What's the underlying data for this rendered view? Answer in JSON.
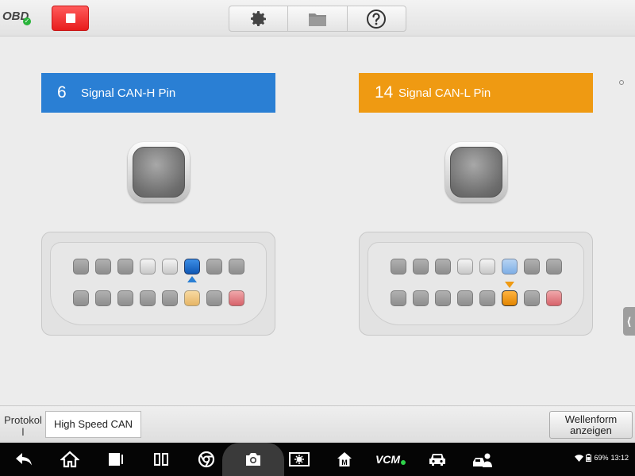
{
  "topbar": {
    "obd_label": "OBD",
    "obd_check": "✓",
    "tools": [
      "settings",
      "folder",
      "help"
    ]
  },
  "signals": {
    "left": {
      "number": "6",
      "label": "Signal CAN-H Pin"
    },
    "right": {
      "number": "14",
      "label": "Signal CAN-L Pin"
    }
  },
  "colors": {
    "can_h": "#2a7fd4",
    "can_l": "#ef9a12",
    "stop": "#e81c1c",
    "pin_error": "#d7626a"
  },
  "side_tab_glyph": "⟨",
  "bottombar": {
    "protocol_label": "Protokol l",
    "protocol_value": "High Speed CAN",
    "waveform_line1": "Wellenform",
    "waveform_line2": "anzeigen"
  },
  "statusbar": {
    "battery": "69%",
    "time": "13:12",
    "vcm_label": "VCM"
  }
}
